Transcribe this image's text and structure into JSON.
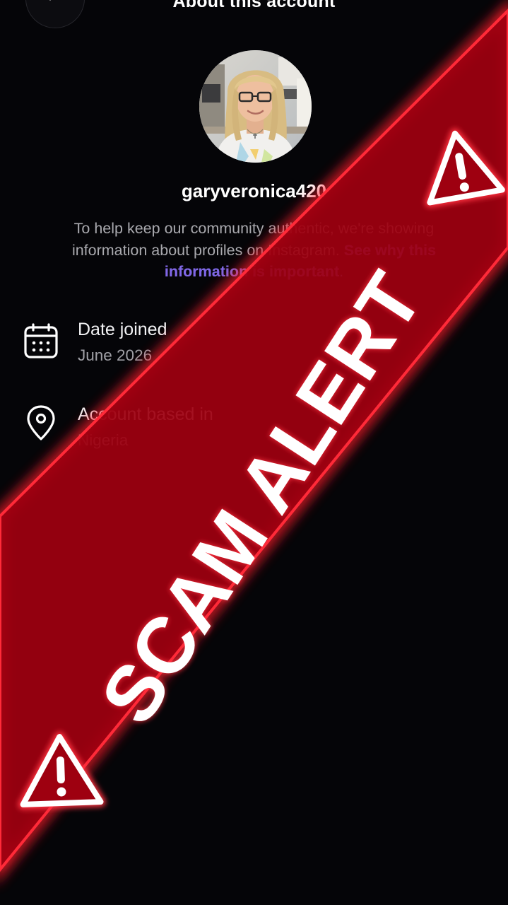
{
  "header": {
    "title": "About this account",
    "back_icon": "chevron-left-icon"
  },
  "profile": {
    "username": "garyveronica420",
    "description": "To help keep our community authentic, we're showing information about profiles on Instagram.",
    "link_text": "See why this information is important",
    "link_suffix": "."
  },
  "info": {
    "date_joined": {
      "title": "Date joined",
      "value": "June 2026",
      "icon": "calendar-icon"
    },
    "account_based_in": {
      "title": "Account based in",
      "value": "Nigeria",
      "icon": "location-pin-icon"
    }
  },
  "overlay": {
    "text": "SCAM ALERT",
    "warning_icon": "warning-triangle-icon",
    "colors": {
      "banner": "#b5000f",
      "glow": "#ff1a2a",
      "text": "#ffffff"
    }
  }
}
